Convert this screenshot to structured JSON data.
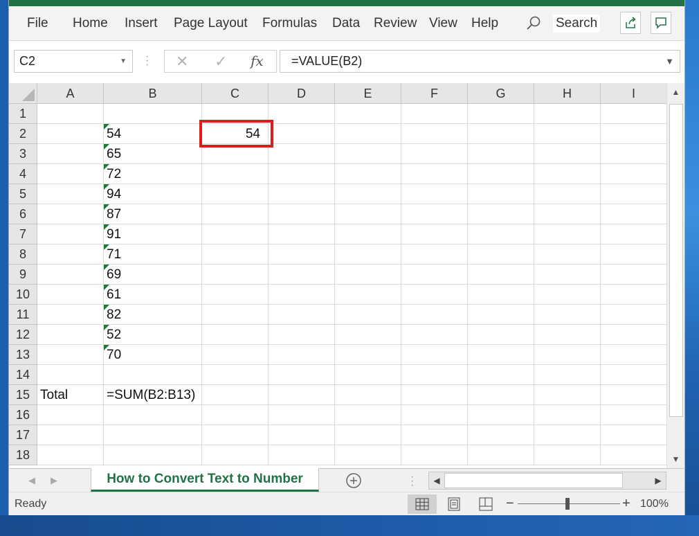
{
  "ribbon": {
    "menu": [
      "File",
      "Home",
      "Insert",
      "Page Layout",
      "Formulas",
      "Data",
      "Review",
      "View",
      "Help"
    ],
    "search_label": "Search"
  },
  "formula_bar": {
    "name_box": "C2",
    "cancel_symbol": "✕",
    "enter_symbol": "✓",
    "fx_symbol": "fx",
    "formula": "=VALUE(B2)"
  },
  "grid": {
    "columns": [
      "A",
      "B",
      "C",
      "D",
      "E",
      "F",
      "G",
      "H",
      "I"
    ],
    "rows": [
      "1",
      "2",
      "3",
      "4",
      "5",
      "6",
      "7",
      "8",
      "9",
      "10",
      "11",
      "12",
      "13",
      "14",
      "15",
      "16",
      "17",
      "18"
    ],
    "column_b_values": [
      "54",
      "65",
      "72",
      "94",
      "87",
      "91",
      "71",
      "69",
      "61",
      "82",
      "52",
      "70"
    ],
    "c2_value": "54",
    "a15": "Total",
    "b15": "=SUM(B2:B13)"
  },
  "sheet_tabs": {
    "active": "How to Convert Text to Number"
  },
  "status_bar": {
    "ready": "Ready",
    "zoom_minus": "−",
    "zoom_plus": "+",
    "zoom": "100%"
  },
  "colors": {
    "excel_green": "#217346",
    "selection_red": "#e01b1b",
    "text_number_flag": "#1e7b34"
  }
}
